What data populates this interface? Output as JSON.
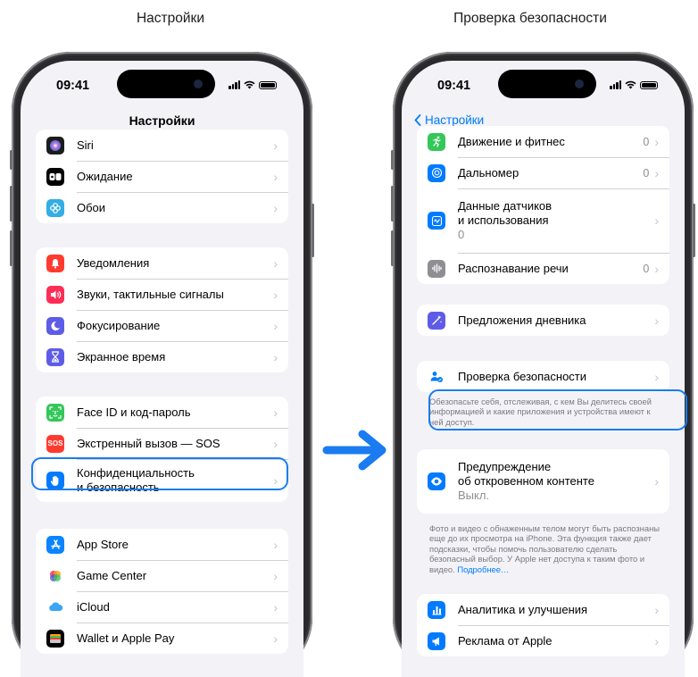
{
  "captions": {
    "left": "Настройки",
    "right": "Проверка безопасности"
  },
  "status": {
    "time": "09:41"
  },
  "left_screen": {
    "title": "Настройки",
    "group1": [
      {
        "label": "Siri",
        "icon": "siri-icon",
        "color": "#1c1c1e"
      },
      {
        "label": "Ожидание",
        "icon": "standby-icon",
        "color": "#000000"
      },
      {
        "label": "Обои",
        "icon": "wallpaper-icon",
        "color": "#32ade6"
      }
    ],
    "group2": [
      {
        "label": "Уведомления",
        "icon": "bell-icon",
        "color": "#ff3b30"
      },
      {
        "label": "Звуки, тактильные сигналы",
        "icon": "speaker-icon",
        "color": "#ff2d55"
      },
      {
        "label": "Фокусирование",
        "icon": "moon-icon",
        "color": "#5e5ce6"
      },
      {
        "label": "Экранное время",
        "icon": "hourglass-icon",
        "color": "#5e5ce6"
      }
    ],
    "group3": [
      {
        "label": "Face ID и код-пароль",
        "icon": "faceid-icon",
        "color": "#34c759"
      },
      {
        "label": "Экстренный вызов — SOS",
        "icon": "sos-icon",
        "color": "#ff3b30",
        "glyph": "SOS"
      },
      {
        "label1": "Конфиденциальность",
        "label2": "и безопасность",
        "icon": "hand-icon",
        "color": "#007aff"
      }
    ],
    "group4": [
      {
        "label": "App Store",
        "icon": "appstore-icon",
        "color": "#0a84ff"
      },
      {
        "label": "Game Center",
        "icon": "gamecenter-icon",
        "color": "#ffffff"
      },
      {
        "label": "iCloud",
        "icon": "icloud-icon",
        "color": "#ffffff"
      },
      {
        "label": "Wallet и Apple Pay",
        "icon": "wallet-icon",
        "color": "#000000"
      }
    ]
  },
  "right_screen": {
    "back_label": "Настройки",
    "group1": [
      {
        "label": "Движение и фитнес",
        "value": "0",
        "icon": "fitness-icon",
        "color": "#34c759"
      },
      {
        "label": "Дальномер",
        "value": "0",
        "icon": "measure-icon",
        "color": "#007aff"
      },
      {
        "label1": "Данные датчиков",
        "label2": "и использования",
        "sub": "0",
        "icon": "sensor-icon",
        "color": "#007aff"
      },
      {
        "label": "Распознавание речи",
        "value": "0",
        "icon": "speech-icon",
        "color": "#8e8e93"
      }
    ],
    "journal": {
      "label": "Предложения дневника",
      "icon": "journal-icon",
      "color": "#5e5ce6"
    },
    "safety": {
      "label": "Проверка безопасности",
      "icon": "safety-check-icon",
      "color": "#007aff"
    },
    "safety_note": "Обезопасьте себя, отслеживая, с кем Вы делитесь своей информацией и какие приложения и устройства имеют к ней доступ.",
    "sensitive": {
      "label1": "Предупреждение",
      "label2": "об откровенном контенте",
      "sub": "Выкл.",
      "icon": "sensitive-content-icon",
      "color": "#007aff"
    },
    "sensitive_note": "Фото и видео с обнаженным телом могут быть распознаны еще до их просмотра на iPhone. Эта функция также дает подсказки, чтобы помочь пользователю сделать безопасный выбор. У Apple нет доступа к таким фото и видео.",
    "sensitive_link": "Подробнее…",
    "group4": [
      {
        "label": "Аналитика и улучшения",
        "icon": "analytics-icon",
        "color": "#007aff"
      },
      {
        "label": "Реклама от Apple",
        "icon": "ads-icon",
        "color": "#007aff"
      }
    ]
  }
}
